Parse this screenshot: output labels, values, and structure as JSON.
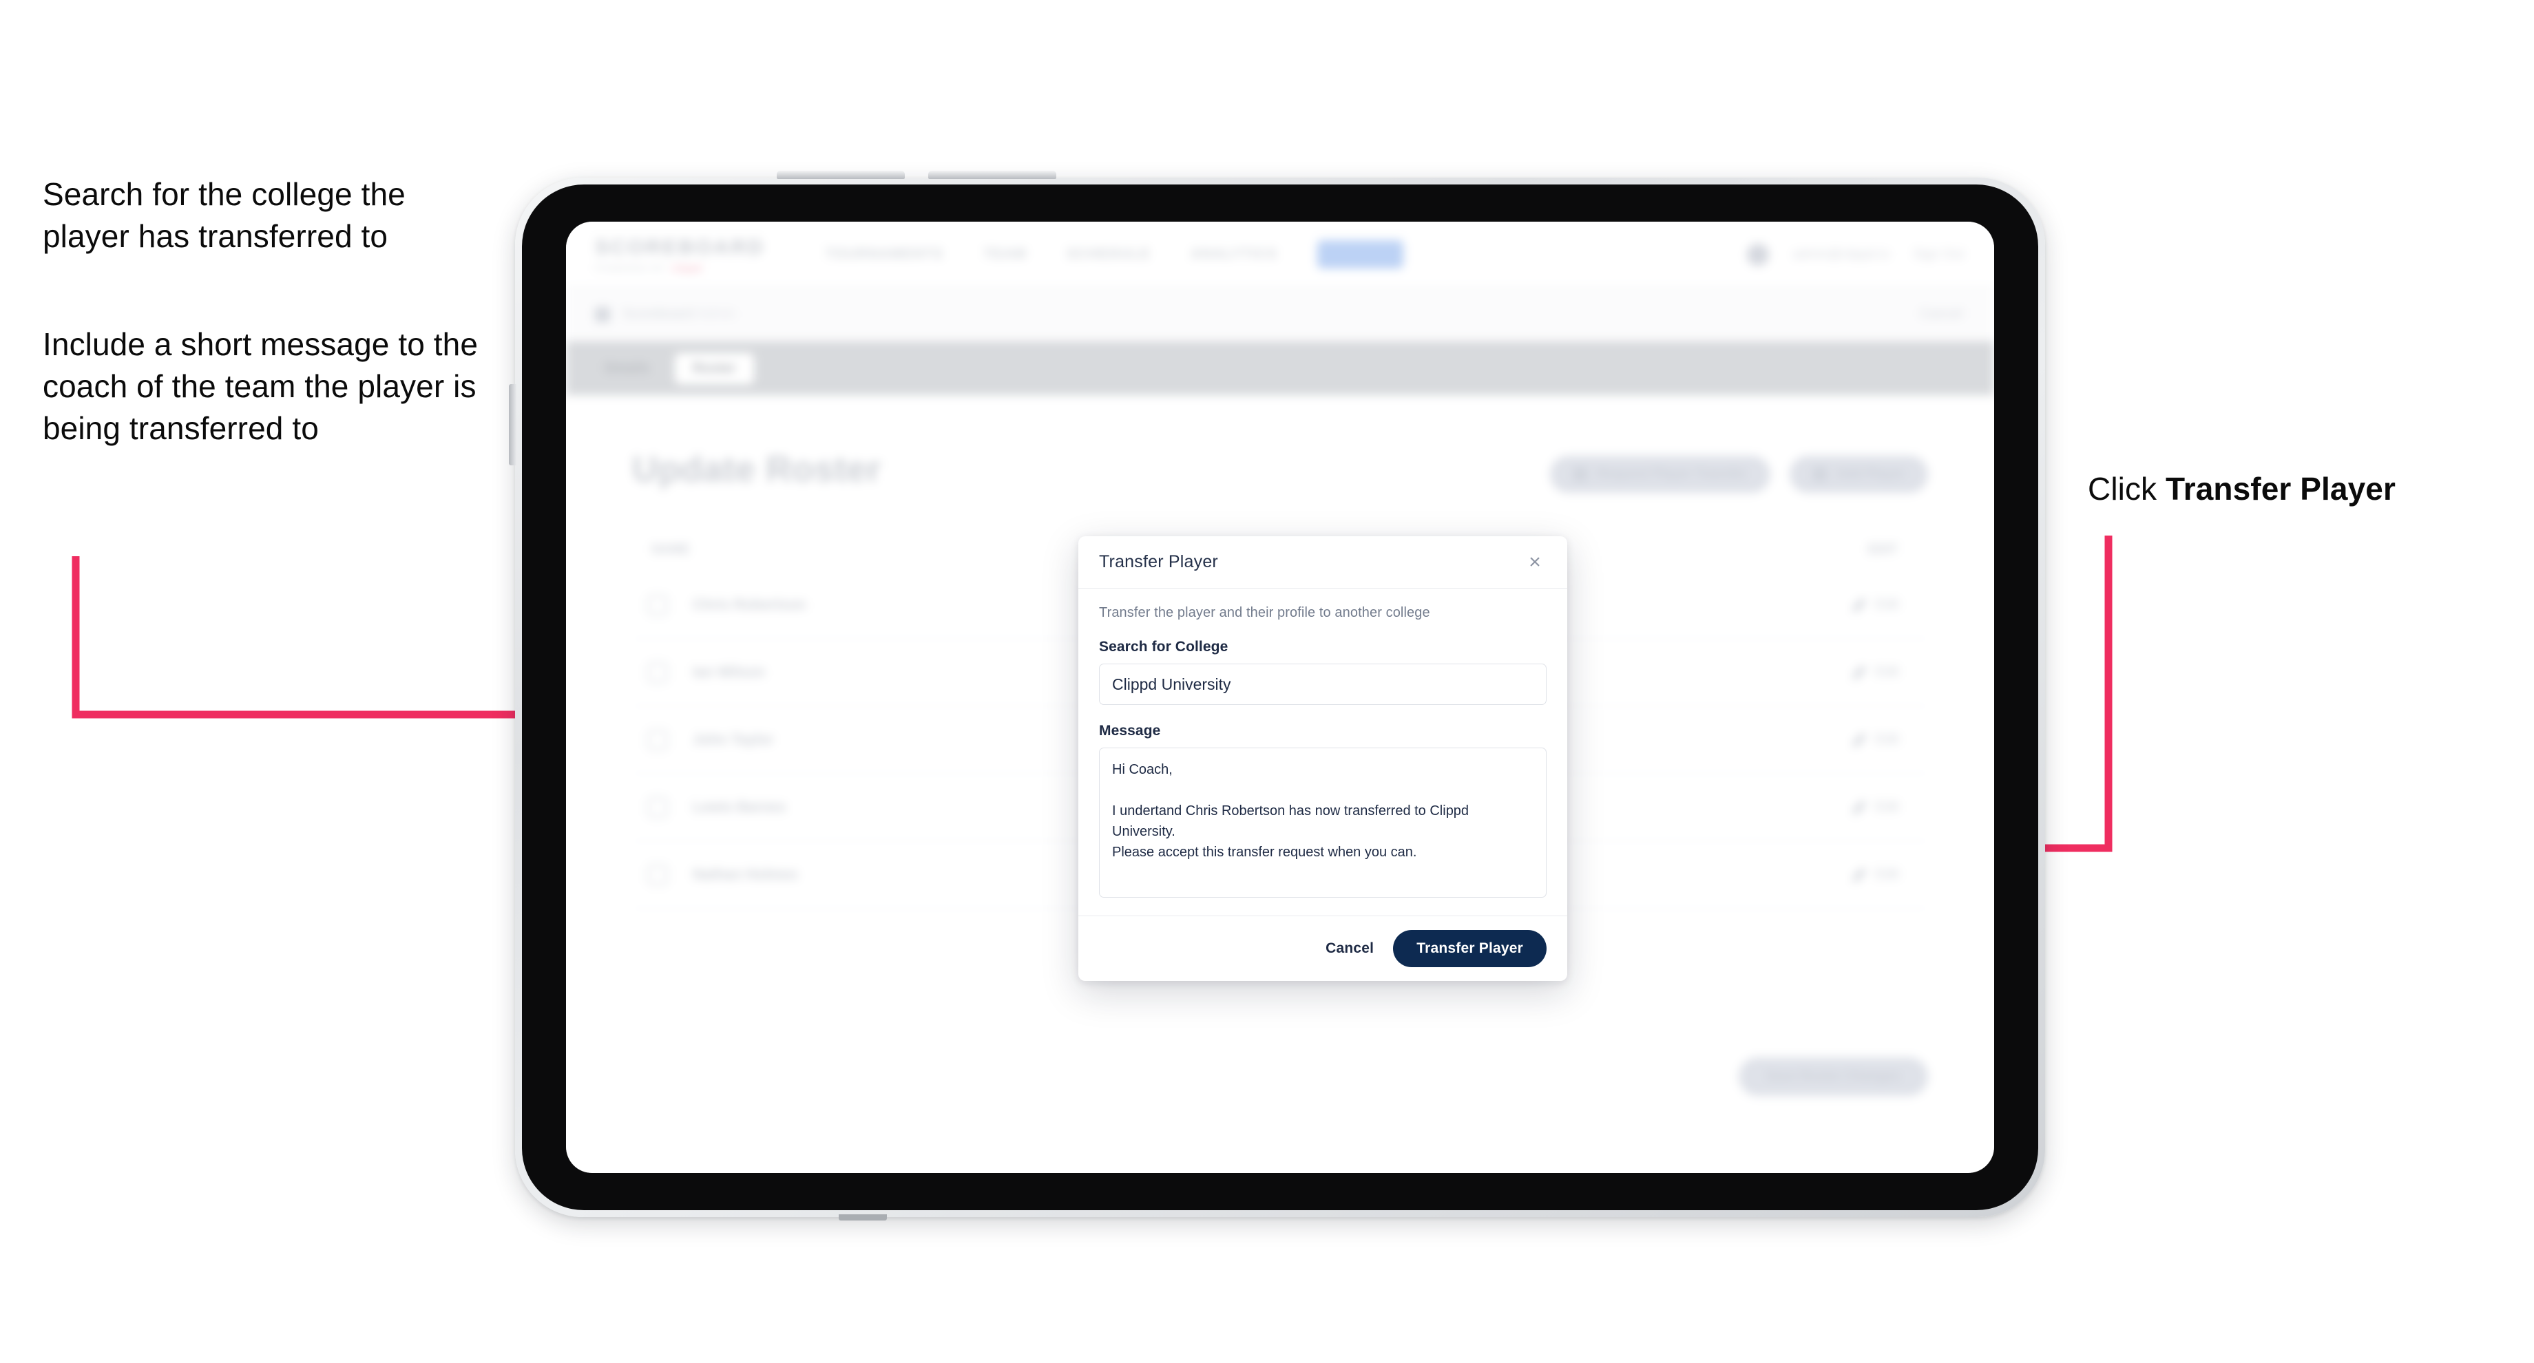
{
  "annotations": {
    "left_1": "Search for the college the player has transferred to",
    "left_2": "Include a short message to the coach of the team the player is being transferred to",
    "right_prefix": "Click ",
    "right_bold": "Transfer Player"
  },
  "accent": {
    "arrow": "#EF2D60",
    "primary_button": "#0D2A51",
    "nav_pill": "#BCD2F5"
  },
  "app": {
    "brand": {
      "word": "SCOREBOARD",
      "sub": "POWERED BY",
      "mark": "clippd"
    },
    "topnav": [
      {
        "label": "TOURNAMENTS"
      },
      {
        "label": "TEAM"
      },
      {
        "label": "SCHEDULE"
      },
      {
        "label": "ANALYTICS"
      },
      {
        "label": "ADMIN"
      }
    ],
    "header_right": {
      "email": "admin@clippd.io",
      "signout": "Sign Out"
    },
    "subbar": {
      "crumb": "Scoreboard",
      "crumb_muted": "Admin",
      "right": "Cancel"
    },
    "tabs": [
      {
        "label": "Details",
        "active": false
      },
      {
        "label": "Roster",
        "active": true
      }
    ],
    "page_title": "Update Roster",
    "action_pills": [
      {
        "label": "Request Player Transfer"
      },
      {
        "label": "Add Player"
      }
    ],
    "roster": {
      "col_name": "NAME",
      "col_edit": "EDIT",
      "edit_label": "Edit",
      "rows": [
        {
          "name": "Chris Robertson"
        },
        {
          "name": "Ian Wilson"
        },
        {
          "name": "John Taylor"
        },
        {
          "name": "Lewis Barnes"
        },
        {
          "name": "Nathan Holmes"
        }
      ]
    },
    "save_button": "Save Roster Changes"
  },
  "modal": {
    "title": "Transfer Player",
    "close_icon": "×",
    "subtitle": "Transfer the player and their profile to another college",
    "college_label": "Search for College",
    "college_value": "Clippd University",
    "college_placeholder": "Search for College",
    "message_label": "Message",
    "message_value": "Hi Coach,\n\nI undertand Chris Robertson has now transferred to Clippd University.\nPlease accept this transfer request when you can.",
    "message_placeholder": "Message",
    "cancel_label": "Cancel",
    "submit_label": "Transfer Player"
  }
}
